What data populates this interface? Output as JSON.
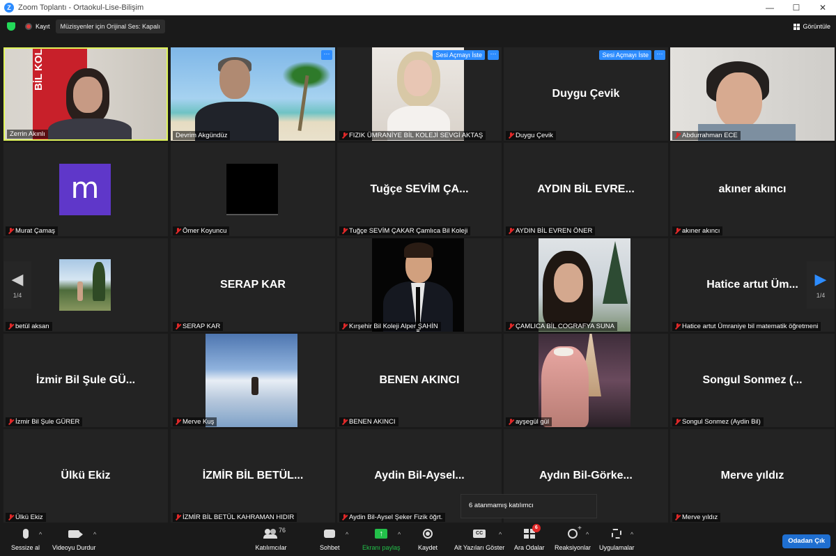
{
  "window": {
    "title": "Zoom Toplantı - Ortaokul-Lise-Bilişim",
    "app_icon": "Z",
    "minimize": "—",
    "maximize": "☐",
    "close": "✕"
  },
  "topbar": {
    "record_label": "Kayıt",
    "original_sound_label": "Müzisyenler için Orijinal Ses: Kapalı",
    "view_label": "Görüntüle"
  },
  "tiles": [
    {
      "label": "Zerrin Akınlı",
      "big_name": "",
      "muted": false
    },
    {
      "label": "Devrim Akgündüz",
      "big_name": "",
      "muted": false
    },
    {
      "label": "FIZIK ÜMRANİYE BİL KOLEJİ SEVGİ AKTAŞ",
      "big_name": "",
      "muted": true
    },
    {
      "label": "Duygu Çevik",
      "big_name": "Duygu Çevik",
      "muted": true
    },
    {
      "label": "Abdurrahman ECE",
      "big_name": "",
      "muted": true
    },
    {
      "label": "Murat Çamaş",
      "big_name": "",
      "muted": true
    },
    {
      "label": "Ömer Koyuncu",
      "big_name": "",
      "muted": true
    },
    {
      "label": "Tuğçe SEVİM ÇAKAR Çamlıca Bil Koleji",
      "big_name": "Tuğçe SEVİM ÇA...",
      "muted": true
    },
    {
      "label": "AYDIN BİL EVREN ÖNER",
      "big_name": "AYDIN BİL EVRE...",
      "muted": true
    },
    {
      "label": "akıner akıncı",
      "big_name": "akıner akıncı",
      "muted": true
    },
    {
      "label": "betül aksan",
      "big_name": "",
      "muted": true
    },
    {
      "label": "SERAP KAR",
      "big_name": "SERAP KAR",
      "muted": true
    },
    {
      "label": "Kırşehir Bil Koleji Alper ŞAHİN",
      "big_name": "",
      "muted": true
    },
    {
      "label": "ÇAMLICA BİL COGRAFYA SUNA",
      "big_name": "",
      "muted": true
    },
    {
      "label": "Hatice artut Ümraniye bil matematik öğretmeni",
      "big_name": "Hatice artut Üm...",
      "muted": true
    },
    {
      "label": "İzmir Bil Şule GÜRER",
      "big_name": "İzmir Bil Şule GÜ...",
      "muted": true
    },
    {
      "label": "Merve Kuş",
      "big_name": "",
      "muted": true
    },
    {
      "label": "BENEN AKINCI",
      "big_name": "BENEN AKINCI",
      "muted": true
    },
    {
      "label": "ayşegül gül",
      "big_name": "",
      "muted": true
    },
    {
      "label": "Songul Sonmez (Aydin Bil)",
      "big_name": "Songul Sonmez (...",
      "muted": true
    },
    {
      "label": "Ülkü Ekiz",
      "big_name": "Ülkü Ekiz",
      "muted": true
    },
    {
      "label": "İZMİR BİL BETÜL KAHRAMAN HIDIR",
      "big_name": "İZMİR BİL BETÜL...",
      "muted": true
    },
    {
      "label": "Aydin Bil-Aysel Şeker Fizik öğrt.",
      "big_name": "Aydin Bil-Aysel...",
      "muted": true
    },
    {
      "label": "",
      "big_name": "Aydın Bil-Görke...",
      "muted": true
    },
    {
      "label": "Merve yıldız",
      "big_name": "Merve yıldız",
      "muted": true
    }
  ],
  "tile_controls": {
    "unmute_request": "Sesi Açmayı İste",
    "more": "···",
    "avatar_letter": "m",
    "zerrin_banner": "BİL KOLEJİ"
  },
  "pager": {
    "left_arrow": "◀",
    "right_arrow": "▶",
    "page": "1/4"
  },
  "tooltip": "6 atanmamış katılımcı",
  "toolbar": {
    "mute": "Sessize al",
    "stop_video": "Videoyu Durdur",
    "participants": "Katılımcılar",
    "participants_count": "76",
    "chat": "Sohbet",
    "share": "Ekranı paylaş",
    "record": "Kaydet",
    "captions": "Alt Yazıları Göster",
    "captions_icon": "CC",
    "breakout": "Ara Odalar",
    "breakout_badge": "6",
    "reactions": "Reaksiyonlar",
    "apps": "Uygulamalar",
    "leave": "Odadan Çık",
    "caret": "^",
    "share_arrow": "↑"
  },
  "colors": {
    "accent_blue": "#2d8cff",
    "active_speaker": "#e0f55a",
    "share_green": "#23c04a",
    "muted_red": "#e02828"
  }
}
